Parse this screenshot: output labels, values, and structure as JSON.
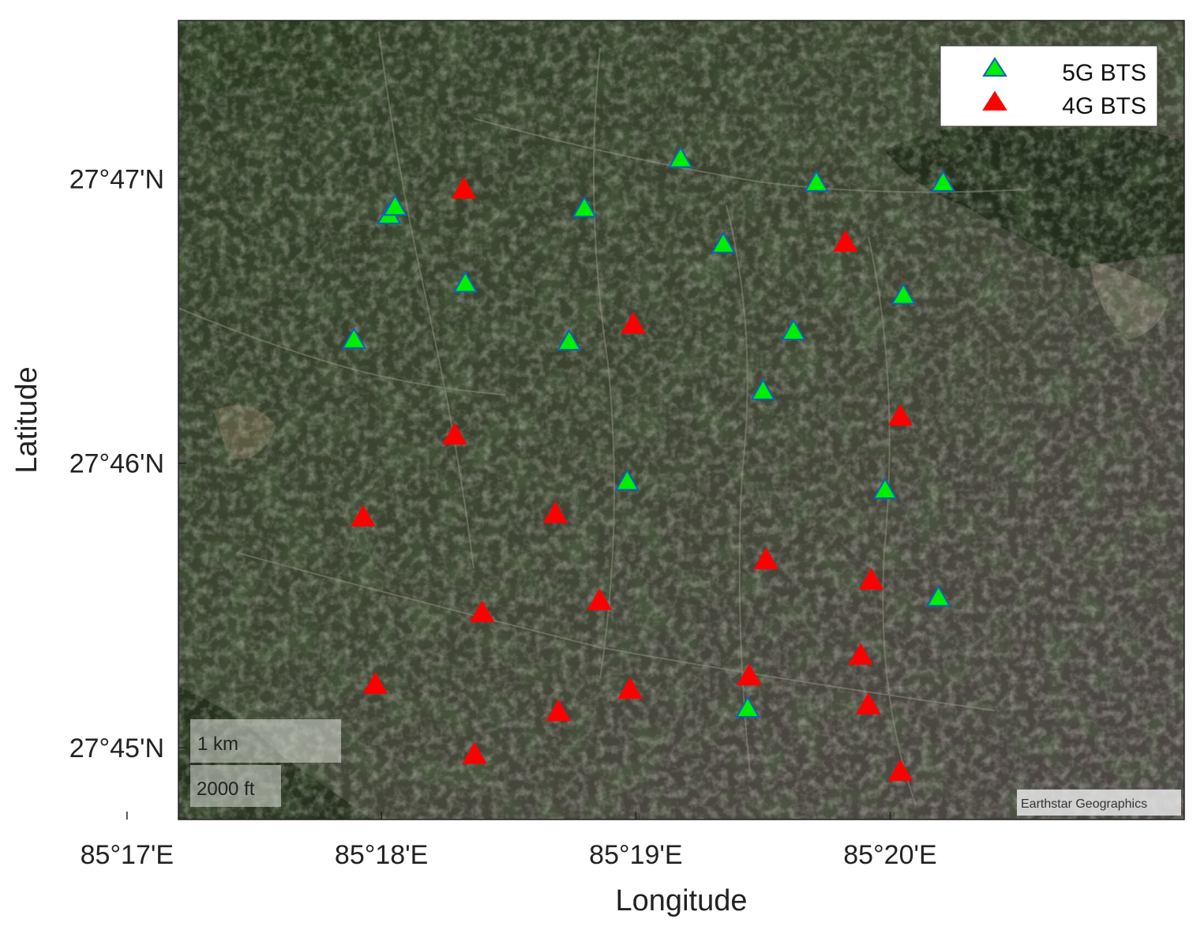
{
  "map": {
    "basemap_attribution": "Earthstar Geographics",
    "xlabel": "Longitude",
    "ylabel": "Latitude",
    "x_ticks": [
      {
        "value": 85.28333,
        "label": "85°17'E"
      },
      {
        "value": 85.3,
        "label": "85°18'E"
      },
      {
        "value": 85.31667,
        "label": "85°19'E"
      },
      {
        "value": 85.33333,
        "label": "85°20'E"
      }
    ],
    "y_ticks": [
      {
        "value": 27.78333,
        "label": "27°47'N"
      },
      {
        "value": 27.76667,
        "label": "27°46'N"
      },
      {
        "value": 27.75,
        "label": "27°45'N"
      }
    ],
    "xlim": [
      85.2867,
      85.3526
    ],
    "ylim": [
      27.7458,
      27.7926
    ],
    "scale_bar": {
      "metric_label": "1 km",
      "imperial_label": "2000 ft"
    },
    "legend": {
      "placement": "top-right",
      "entries": [
        {
          "label": "5G BTS",
          "color": "#00ee00",
          "edge": "#1060c0"
        },
        {
          "label": "4G BTS",
          "color": "#ff0000",
          "edge": "#ff0000"
        }
      ]
    }
  },
  "chart_data": {
    "type": "scatter",
    "xlabel": "Longitude",
    "ylabel": "Latitude",
    "series": [
      {
        "name": "5G BTS",
        "color": "#00ee00",
        "points": [
          {
            "lon": 85.3196,
            "lat": 27.7845
          },
          {
            "lon": 85.3285,
            "lat": 27.7831
          },
          {
            "lon": 85.3368,
            "lat": 27.7831
          },
          {
            "lon": 85.3005,
            "lat": 27.7812
          },
          {
            "lon": 85.3009,
            "lat": 27.7817
          },
          {
            "lon": 85.3133,
            "lat": 27.7816
          },
          {
            "lon": 85.3224,
            "lat": 27.7795
          },
          {
            "lon": 85.3055,
            "lat": 27.7772
          },
          {
            "lon": 85.3342,
            "lat": 27.7765
          },
          {
            "lon": 85.327,
            "lat": 27.7744
          },
          {
            "lon": 85.2982,
            "lat": 27.7739
          },
          {
            "lon": 85.3123,
            "lat": 27.7738
          },
          {
            "lon": 85.325,
            "lat": 27.7709
          },
          {
            "lon": 85.3161,
            "lat": 27.7656
          },
          {
            "lon": 85.333,
            "lat": 27.7651
          },
          {
            "lon": 85.3365,
            "lat": 27.7588
          },
          {
            "lon": 85.324,
            "lat": 27.7523
          }
        ]
      },
      {
        "name": "4G BTS",
        "color": "#ff0000",
        "points": [
          {
            "lon": 85.3054,
            "lat": 27.7827
          },
          {
            "lon": 85.3304,
            "lat": 27.7796
          },
          {
            "lon": 85.3165,
            "lat": 27.7748
          },
          {
            "lon": 85.3048,
            "lat": 27.7683
          },
          {
            "lon": 85.334,
            "lat": 27.7694
          },
          {
            "lon": 85.2988,
            "lat": 27.7635
          },
          {
            "lon": 85.3114,
            "lat": 27.7637
          },
          {
            "lon": 85.3252,
            "lat": 27.761
          },
          {
            "lon": 85.3321,
            "lat": 27.7598
          },
          {
            "lon": 85.3143,
            "lat": 27.7586
          },
          {
            "lon": 85.3066,
            "lat": 27.7579
          },
          {
            "lon": 85.3314,
            "lat": 27.7554
          },
          {
            "lon": 85.2996,
            "lat": 27.7537
          },
          {
            "lon": 85.3163,
            "lat": 27.7534
          },
          {
            "lon": 85.3241,
            "lat": 27.7542
          },
          {
            "lon": 85.3116,
            "lat": 27.7521
          },
          {
            "lon": 85.3319,
            "lat": 27.7525
          },
          {
            "lon": 85.3061,
            "lat": 27.7496
          },
          {
            "lon": 85.334,
            "lat": 27.7486
          }
        ]
      }
    ]
  }
}
